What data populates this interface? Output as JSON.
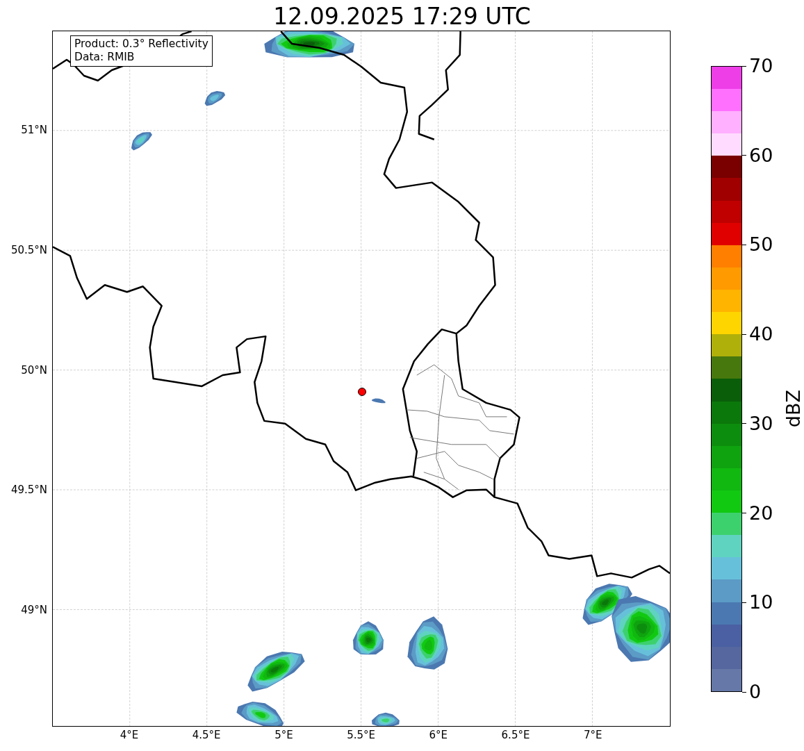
{
  "title": "12.09.2025 17:29 UTC",
  "info_box": [
    "Product: 0.3° Reflectivity",
    "Data: RMIB"
  ],
  "map": {
    "lat_labels": [
      "51°N",
      "50.5°N",
      "50°N",
      "49.5°N",
      "49°N"
    ],
    "lon_labels": [
      "4°E",
      "4.5°E",
      "5°E",
      "5.5°E",
      "6°E",
      "6.5°E",
      "7°E"
    ]
  },
  "colorbar": {
    "label": "dBZ",
    "ticks": [
      "70",
      "60",
      "50",
      "40",
      "30",
      "20",
      "10",
      "0"
    ],
    "bands": [
      {
        "color": "#6678a8"
      },
      {
        "color": "#55679e"
      },
      {
        "color": "#4a60a2"
      },
      {
        "color": "#4b78b0"
      },
      {
        "color": "#5b9bc6"
      },
      {
        "color": "#67c0da"
      },
      {
        "color": "#5fd3c0"
      },
      {
        "color": "#3dd16e"
      },
      {
        "color": "#12c912"
      },
      {
        "color": "#10b810"
      },
      {
        "color": "#0fa30f"
      },
      {
        "color": "#0d8d0d"
      },
      {
        "color": "#0b780b"
      },
      {
        "color": "#0a5e0a"
      },
      {
        "color": "#47780d"
      },
      {
        "color": "#b0b00a"
      },
      {
        "color": "#ffd500"
      },
      {
        "color": "#ffb400"
      },
      {
        "color": "#ff9a00"
      },
      {
        "color": "#ff7f00"
      },
      {
        "color": "#e00000"
      },
      {
        "color": "#c00000"
      },
      {
        "color": "#a00000"
      },
      {
        "color": "#7a0000"
      },
      {
        "color": "#ffdcff"
      },
      {
        "color": "#ffb0ff"
      },
      {
        "color": "#ff70ff"
      },
      {
        "color": "#ee3ee8"
      }
    ]
  }
}
